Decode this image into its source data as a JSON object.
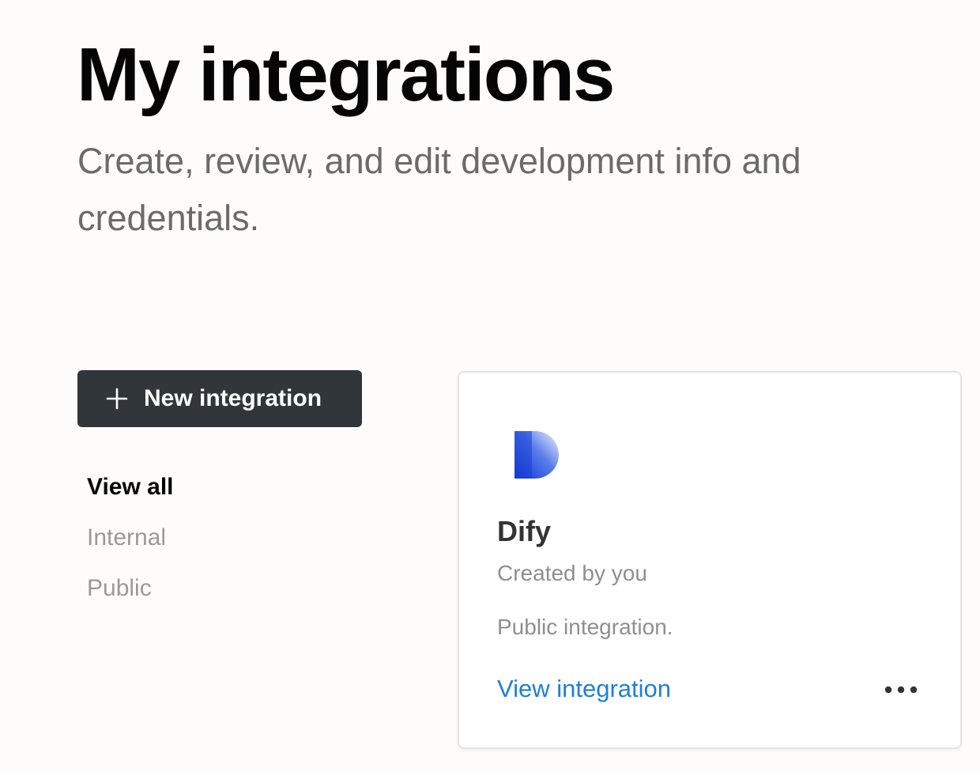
{
  "header": {
    "title": "My integrations",
    "subtitle": "Create, review, and edit development info and credentials."
  },
  "toolbar": {
    "new_integration_label": "New integration",
    "new_integration_icon": "plus-icon"
  },
  "filters": {
    "items": [
      {
        "label": "View all",
        "active": true
      },
      {
        "label": "Internal",
        "active": false
      },
      {
        "label": "Public",
        "active": false
      }
    ]
  },
  "integrations": [
    {
      "name": "Dify",
      "creator": "Created by you",
      "description": "Public integration.",
      "action_label": "View integration",
      "logo_icon": "dify-logo-icon",
      "more_icon": "more-horizontal-icon"
    }
  ],
  "colors": {
    "background": "#fdfcfb",
    "button_bg": "#31363a",
    "link": "#1f7fd6",
    "muted_text": "#8f8f8f",
    "logo_blue": "#1742d6"
  }
}
